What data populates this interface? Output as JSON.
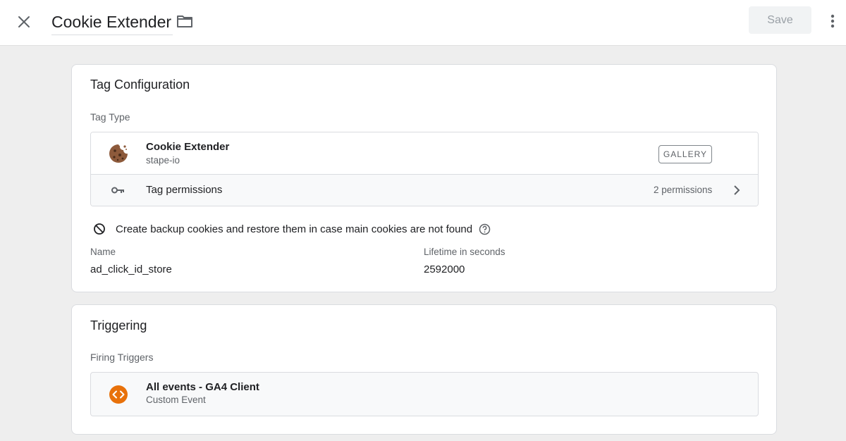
{
  "header": {
    "title": "Cookie Extender",
    "save_label": "Save"
  },
  "tag_config": {
    "title": "Tag Configuration",
    "tag_type_label": "Tag Type",
    "tag_name": "Cookie Extender",
    "tag_vendor": "stape-io",
    "gallery_label": "GALLERY",
    "permissions_label": "Tag permissions",
    "permissions_count": "2 permissions",
    "backup_text": "Create backup cookies and restore them in case main cookies are not found",
    "fields": [
      {
        "label": "Name",
        "value": "ad_click_id_store"
      },
      {
        "label": "Lifetime in seconds",
        "value": "2592000"
      }
    ]
  },
  "triggering": {
    "title": "Triggering",
    "firing_label": "Firing Triggers",
    "trigger_name": "All events - GA4 Client",
    "trigger_type": "Custom Event"
  },
  "colors": {
    "trigger_icon": "#e8710a",
    "cookie": "#8d5a3b"
  },
  "icons": [
    "close-icon",
    "folder-icon",
    "more-vert-icon",
    "cookie-icon",
    "key-icon",
    "chevron-right-icon",
    "block-icon",
    "help-icon",
    "code-icon"
  ]
}
